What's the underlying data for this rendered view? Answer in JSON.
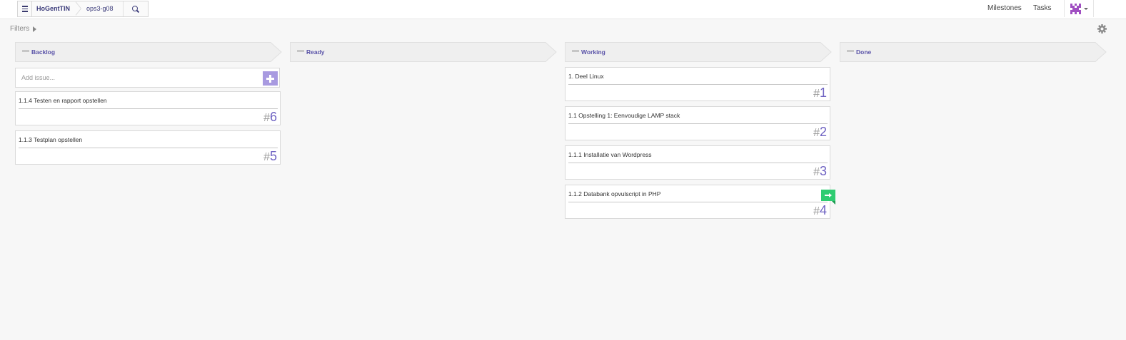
{
  "app": {
    "breadcrumb": {
      "org": "HoGentTIN",
      "repo": "ops3-g08"
    },
    "nav": {
      "milestones": "Milestones",
      "tasks": "Tasks"
    },
    "accent_color": "#5a53a8",
    "add_button_color": "#a89ae0",
    "pr_flag_color": "#2ecc71"
  },
  "filters": {
    "label": "Filters"
  },
  "columns": [
    {
      "name": "Backlog"
    },
    {
      "name": "Ready"
    },
    {
      "name": "Working"
    },
    {
      "name": "Done"
    }
  ],
  "add_issue": {
    "placeholder": "Add issue..."
  },
  "issues": {
    "backlog": [
      {
        "title": "1.1.4 Testen en rapport opstellen",
        "hash": "#",
        "number": "6"
      },
      {
        "title": "1.1.3 Testplan opstellen",
        "hash": "#",
        "number": "5"
      }
    ],
    "working": [
      {
        "title": "1. Deel Linux",
        "hash": "#",
        "number": "1"
      },
      {
        "title": "1.1 Opstelling 1: Eenvoudige LAMP stack",
        "hash": "#",
        "number": "2"
      },
      {
        "title": "1.1.1 Installatie van Wordpress",
        "hash": "#",
        "number": "3"
      },
      {
        "title": "1.1.2 Databank opvulscript in PHP",
        "hash": "#",
        "number": "4",
        "icon": "pull-request-flag-icon"
      }
    ]
  }
}
